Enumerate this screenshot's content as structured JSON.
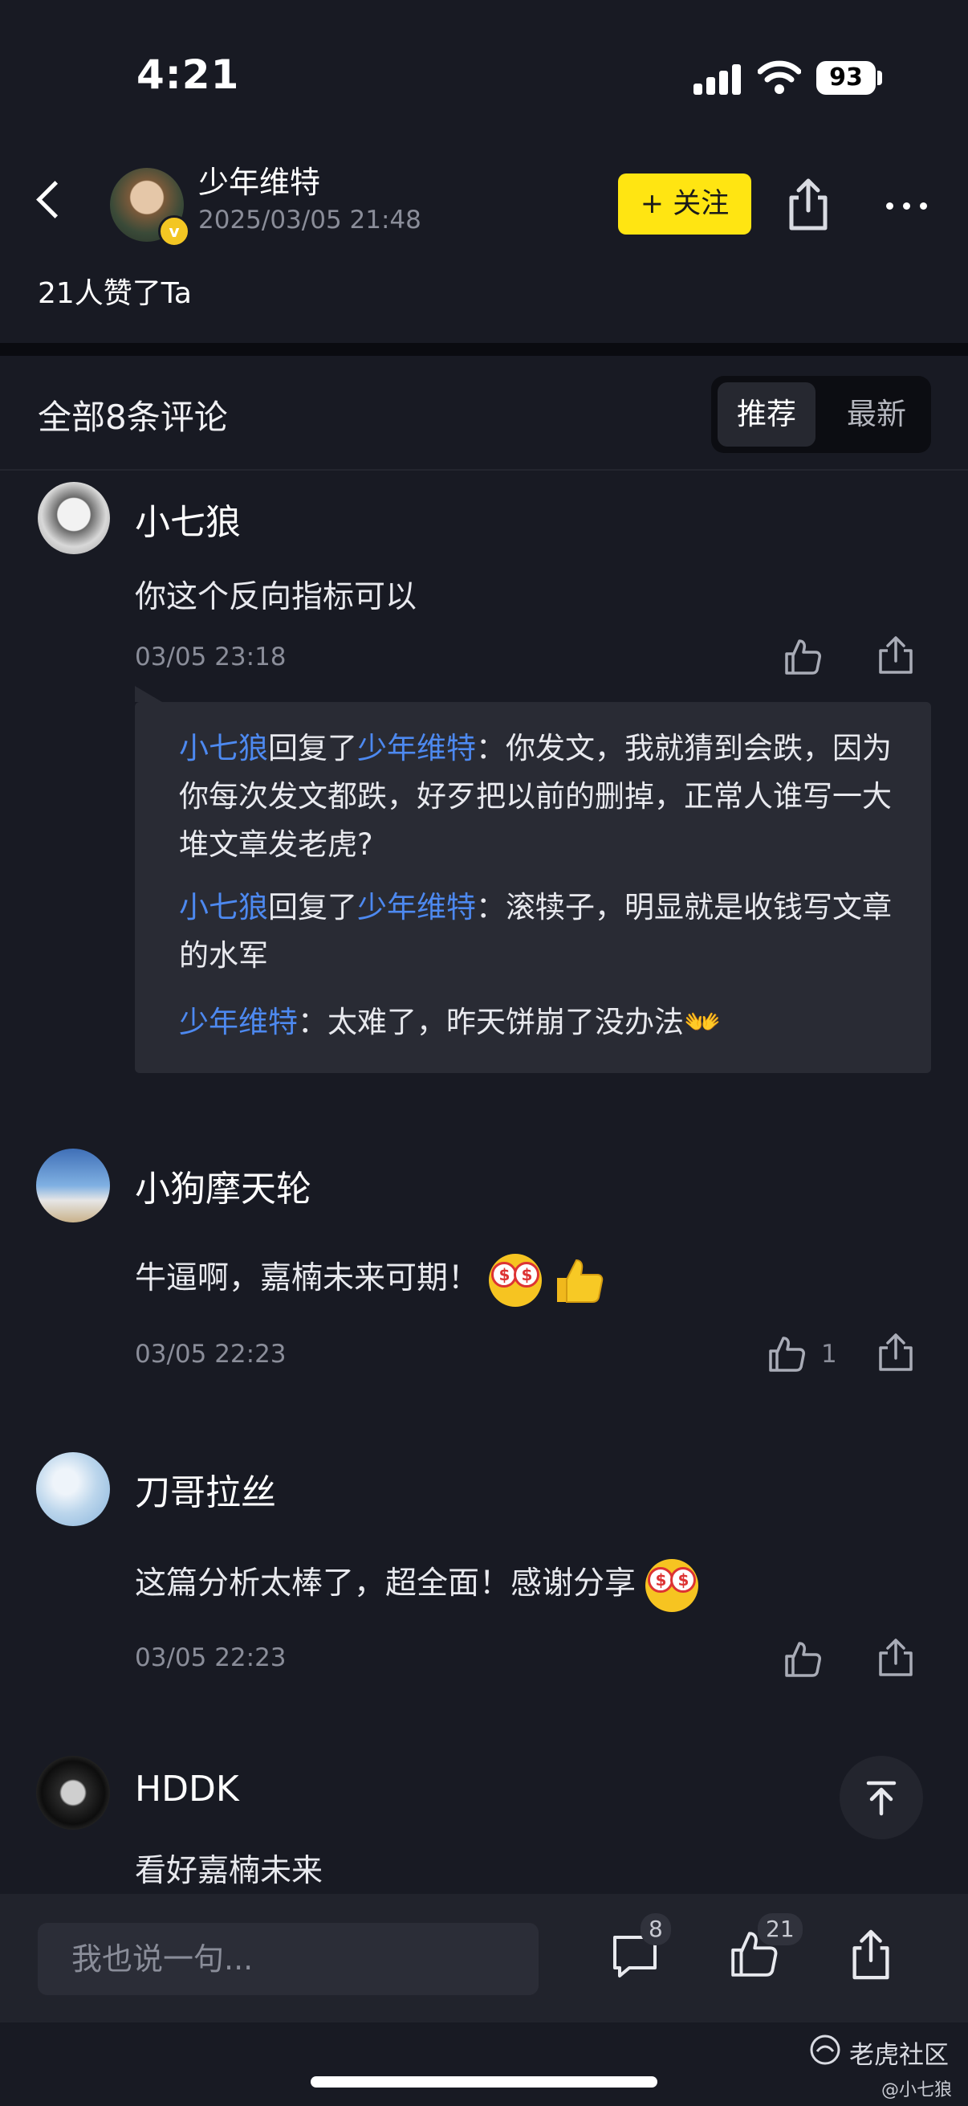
{
  "status_bar": {
    "time": "4:21",
    "battery": "93"
  },
  "header": {
    "author_name": "少年维特",
    "post_date": "2025/03/05 21:48",
    "follow_label": "+ 关注",
    "likes_summary": "21人赞了Ta"
  },
  "comments_header": {
    "count_label": "全部8条评论",
    "sort_options": [
      "推荐",
      "最新"
    ],
    "selected_sort": "推荐"
  },
  "comments": [
    {
      "author": "小七狼",
      "text": "你这个反向指标可以",
      "date": "03/05 23:18",
      "likes": "",
      "replies": [
        {
          "from": "小七狼",
          "verb": "回复了",
          "to": "少年维特",
          "text": "：你发文，我就猜到会跌，因为你每次发文都跌，好歹把以前的删掉，正常人谁写一大堆文章发老虎?"
        },
        {
          "from": "小七狼",
          "verb": "回复了",
          "to": "少年维特",
          "text": "：滚犊子，明显就是收钱写文章的水军"
        },
        {
          "from": "少年维特",
          "verb": "",
          "to": "",
          "text": "：太难了，昨天饼崩了没办法👐"
        }
      ]
    },
    {
      "author": "小狗摩天轮",
      "text": "牛逼啊，嘉楠未来可期！",
      "date": "03/05 22:23",
      "likes": "1"
    },
    {
      "author": "刀哥拉丝",
      "text": "这篇分析太棒了，超全面！感谢分享",
      "date": "03/05 22:23",
      "likes": ""
    },
    {
      "author": "HDDK",
      "text": "看好嘉楠未来",
      "date": "",
      "likes": ""
    }
  ],
  "bottom_bar": {
    "input_placeholder": "我也说一句...",
    "comment_count": "8",
    "like_count": "21"
  },
  "watermark": {
    "brand": "老虎社区",
    "user": "@小七狼"
  },
  "colors": {
    "background": "#181a23",
    "accent_yellow": "#ffe512",
    "link_blue": "#4d89f0",
    "muted": "#8a8d99"
  }
}
